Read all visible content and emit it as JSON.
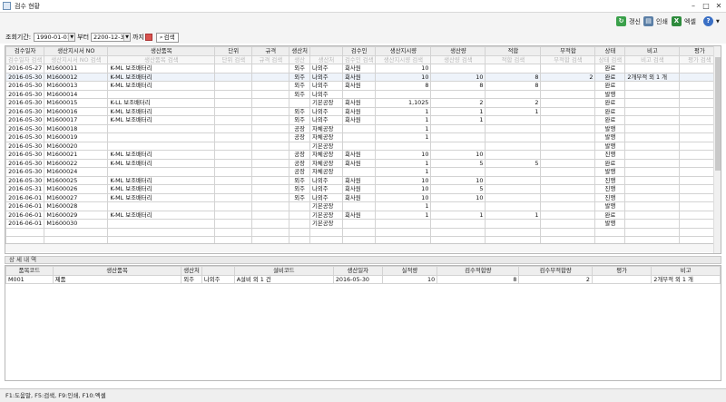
{
  "window": {
    "title": "검수 현황"
  },
  "toolbar": {
    "refresh_label": "갱신",
    "print_label": "인쇄",
    "excel_label": "엑셀"
  },
  "filter": {
    "period_label": "조회기간:",
    "date_from": "1990-01-01",
    "from_suffix": "부터",
    "date_to": "2200-12-31",
    "to_suffix": "까지",
    "search_label": "검색"
  },
  "main_table": {
    "columns": [
      "검수일자",
      "생산지시서 NO",
      "생산품목",
      "단위",
      "규격",
      "생산처",
      "",
      "검수인",
      "생산지시량",
      "생산량",
      "적합",
      "부적합",
      "상태",
      "비고",
      "평가"
    ],
    "filters": [
      "검수일자 검색",
      "생산지시서 NO 검색",
      "생산품목 검색",
      "단위 검색",
      "규격 검색",
      "생산",
      "생산처",
      "검수인 검색",
      "생산지시량 검색",
      "생산량 검색",
      "적합 검색",
      "부적합 검색",
      "상태 검색",
      "비고 검색",
      "평가 검색"
    ],
    "rows": [
      [
        "2016-05-27",
        "M1600011",
        "K-ML 보조배터리",
        "",
        "",
        "외주",
        "나외주",
        "회사원",
        "10",
        "",
        "",
        "",
        "완료",
        "",
        ""
      ],
      [
        "2016-05-30",
        "M1600012",
        "K-ML 보조배터리",
        "",
        "",
        "외주",
        "나외주",
        "회사원",
        "10",
        "10",
        "8",
        "2",
        "완료",
        "2개부적 외 1 개",
        ""
      ],
      [
        "2016-05-30",
        "M1600013",
        "K-ML 보조배터리",
        "",
        "",
        "외주",
        "나외주",
        "회사원",
        "8",
        "8",
        "8",
        "",
        "완료",
        "",
        ""
      ],
      [
        "2016-05-30",
        "M1600014",
        "",
        "",
        "",
        "외주",
        "나외주",
        "",
        "",
        "",
        "",
        "",
        "발행",
        "",
        ""
      ],
      [
        "2016-05-30",
        "M1600015",
        "K-LL 보조배터리",
        "",
        "",
        "",
        "기본공장",
        "회사원",
        "1,1025",
        "2",
        "2",
        "",
        "완료",
        "",
        ""
      ],
      [
        "2016-05-30",
        "M1600016",
        "K-ML 보조배터리",
        "",
        "",
        "외주",
        "나외주",
        "회사원",
        "1",
        "1",
        "1",
        "",
        "완료",
        "",
        ""
      ],
      [
        "2016-05-30",
        "M1600017",
        "K-ML 보조배터리",
        "",
        "",
        "외주",
        "나외주",
        "회사원",
        "1",
        "1",
        "",
        "",
        "완료",
        "",
        ""
      ],
      [
        "2016-05-30",
        "M1600018",
        "",
        "",
        "",
        "공장",
        "자체공장",
        "",
        "1",
        "",
        "",
        "",
        "발행",
        "",
        ""
      ],
      [
        "2016-05-30",
        "M1600019",
        "",
        "",
        "",
        "공장",
        "자체공장",
        "",
        "1",
        "",
        "",
        "",
        "발행",
        "",
        ""
      ],
      [
        "2016-05-30",
        "M1600020",
        "",
        "",
        "",
        "",
        "기본공장",
        "",
        "",
        "",
        "",
        "",
        "발행",
        "",
        ""
      ],
      [
        "2016-05-30",
        "M1600021",
        "K-ML 보조배터리",
        "",
        "",
        "공장",
        "자체공장",
        "회사원",
        "10",
        "10",
        "",
        "",
        "진행",
        "",
        ""
      ],
      [
        "2016-05-30",
        "M1600022",
        "K-ML 보조배터리",
        "",
        "",
        "공장",
        "자체공장",
        "회사원",
        "1",
        "5",
        "5",
        "",
        "완료",
        "",
        ""
      ],
      [
        "2016-05-30",
        "M1600024",
        "",
        "",
        "",
        "공장",
        "자체공장",
        "",
        "1",
        "",
        "",
        "",
        "발행",
        "",
        ""
      ],
      [
        "2016-05-30",
        "M1600025",
        "K-ML 보조배터리",
        "",
        "",
        "외주",
        "나외주",
        "회사원",
        "10",
        "10",
        "",
        "",
        "진행",
        "",
        ""
      ],
      [
        "2016-05-31",
        "M1600026",
        "K-ML 보조배터리",
        "",
        "",
        "외주",
        "나외주",
        "회사원",
        "10",
        "5",
        "",
        "",
        "진행",
        "",
        ""
      ],
      [
        "2016-06-01",
        "M1600027",
        "K-ML 보조배터리",
        "",
        "",
        "외주",
        "나외주",
        "회사원",
        "10",
        "10",
        "",
        "",
        "진행",
        "",
        ""
      ],
      [
        "2016-06-01",
        "M1600028",
        "",
        "",
        "",
        "",
        "기본공장",
        "",
        "1",
        "",
        "",
        "",
        "발행",
        "",
        ""
      ],
      [
        "2016-06-01",
        "M1600029",
        "K-ML 보조배터리",
        "",
        "",
        "",
        "기본공장",
        "회사원",
        "1",
        "1",
        "1",
        "",
        "완료",
        "",
        ""
      ],
      [
        "2016-06-01",
        "M1600030",
        "",
        "",
        "",
        "",
        "기본공장",
        "",
        "",
        "",
        "",
        "",
        "발행",
        "",
        ""
      ]
    ]
  },
  "detail": {
    "title": "상 세 내 역",
    "columns": [
      "품목코드",
      "생산품목",
      "생산처",
      "",
      "설비코드",
      "생산일자",
      "실적량",
      "검수적합량",
      "검수부적합량",
      "평가",
      "비고"
    ],
    "rows": [
      [
        "M001",
        "제품",
        "외주",
        "나외주",
        "A설비 외 1 건",
        "2016-05-30",
        "10",
        "8",
        "2",
        "",
        "2개부적 외 1 개"
      ]
    ]
  },
  "statusbar": {
    "text": "F1:도움말, F5:검색, F9:인쇄, F10:엑셀"
  },
  "colors": {
    "refresh": "#3aa04a",
    "print": "#5b7fa6",
    "excel": "#2e8b3d",
    "help": "#3a6fc4"
  }
}
